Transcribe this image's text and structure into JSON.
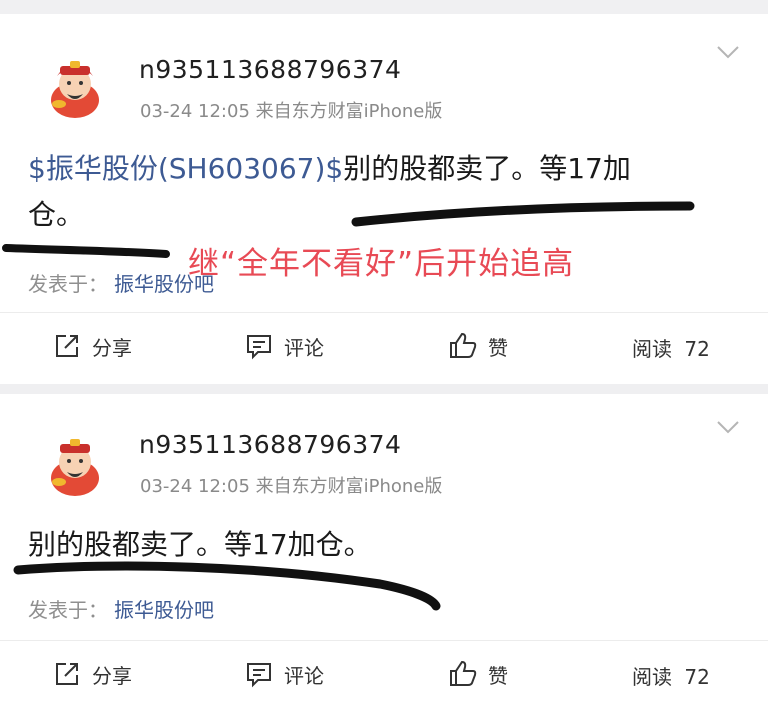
{
  "posts": [
    {
      "username": "n935113688796374",
      "meta": "03-24 12:05  来自东方财富iPhone版",
      "stock_tag": "$振华股份(SH603067)$",
      "text_line1": "别的股都卖了。等17加",
      "text_line2": "仓。",
      "from_label": "发表于：",
      "from_bar": "振华股份吧",
      "share": "分享",
      "comment": "评论",
      "like": "赞",
      "read_label": "阅读",
      "read_count": "72"
    },
    {
      "username": "n935113688796374",
      "meta": "03-24 12:05  来自东方财富iPhone版",
      "text": "别的股都卖了。等17加仓。",
      "from_label": "发表于：",
      "from_bar": "振华股份吧",
      "share": "分享",
      "comment": "评论",
      "like": "赞",
      "read_label": "阅读",
      "read_count": "72"
    }
  ],
  "annotation": {
    "text": "继“全年不看好”后开始追高",
    "color": "#e84a55"
  },
  "icons": [
    "avatar-icon",
    "chevron-down-icon",
    "share-icon",
    "comment-icon",
    "thumbs-up-icon"
  ]
}
